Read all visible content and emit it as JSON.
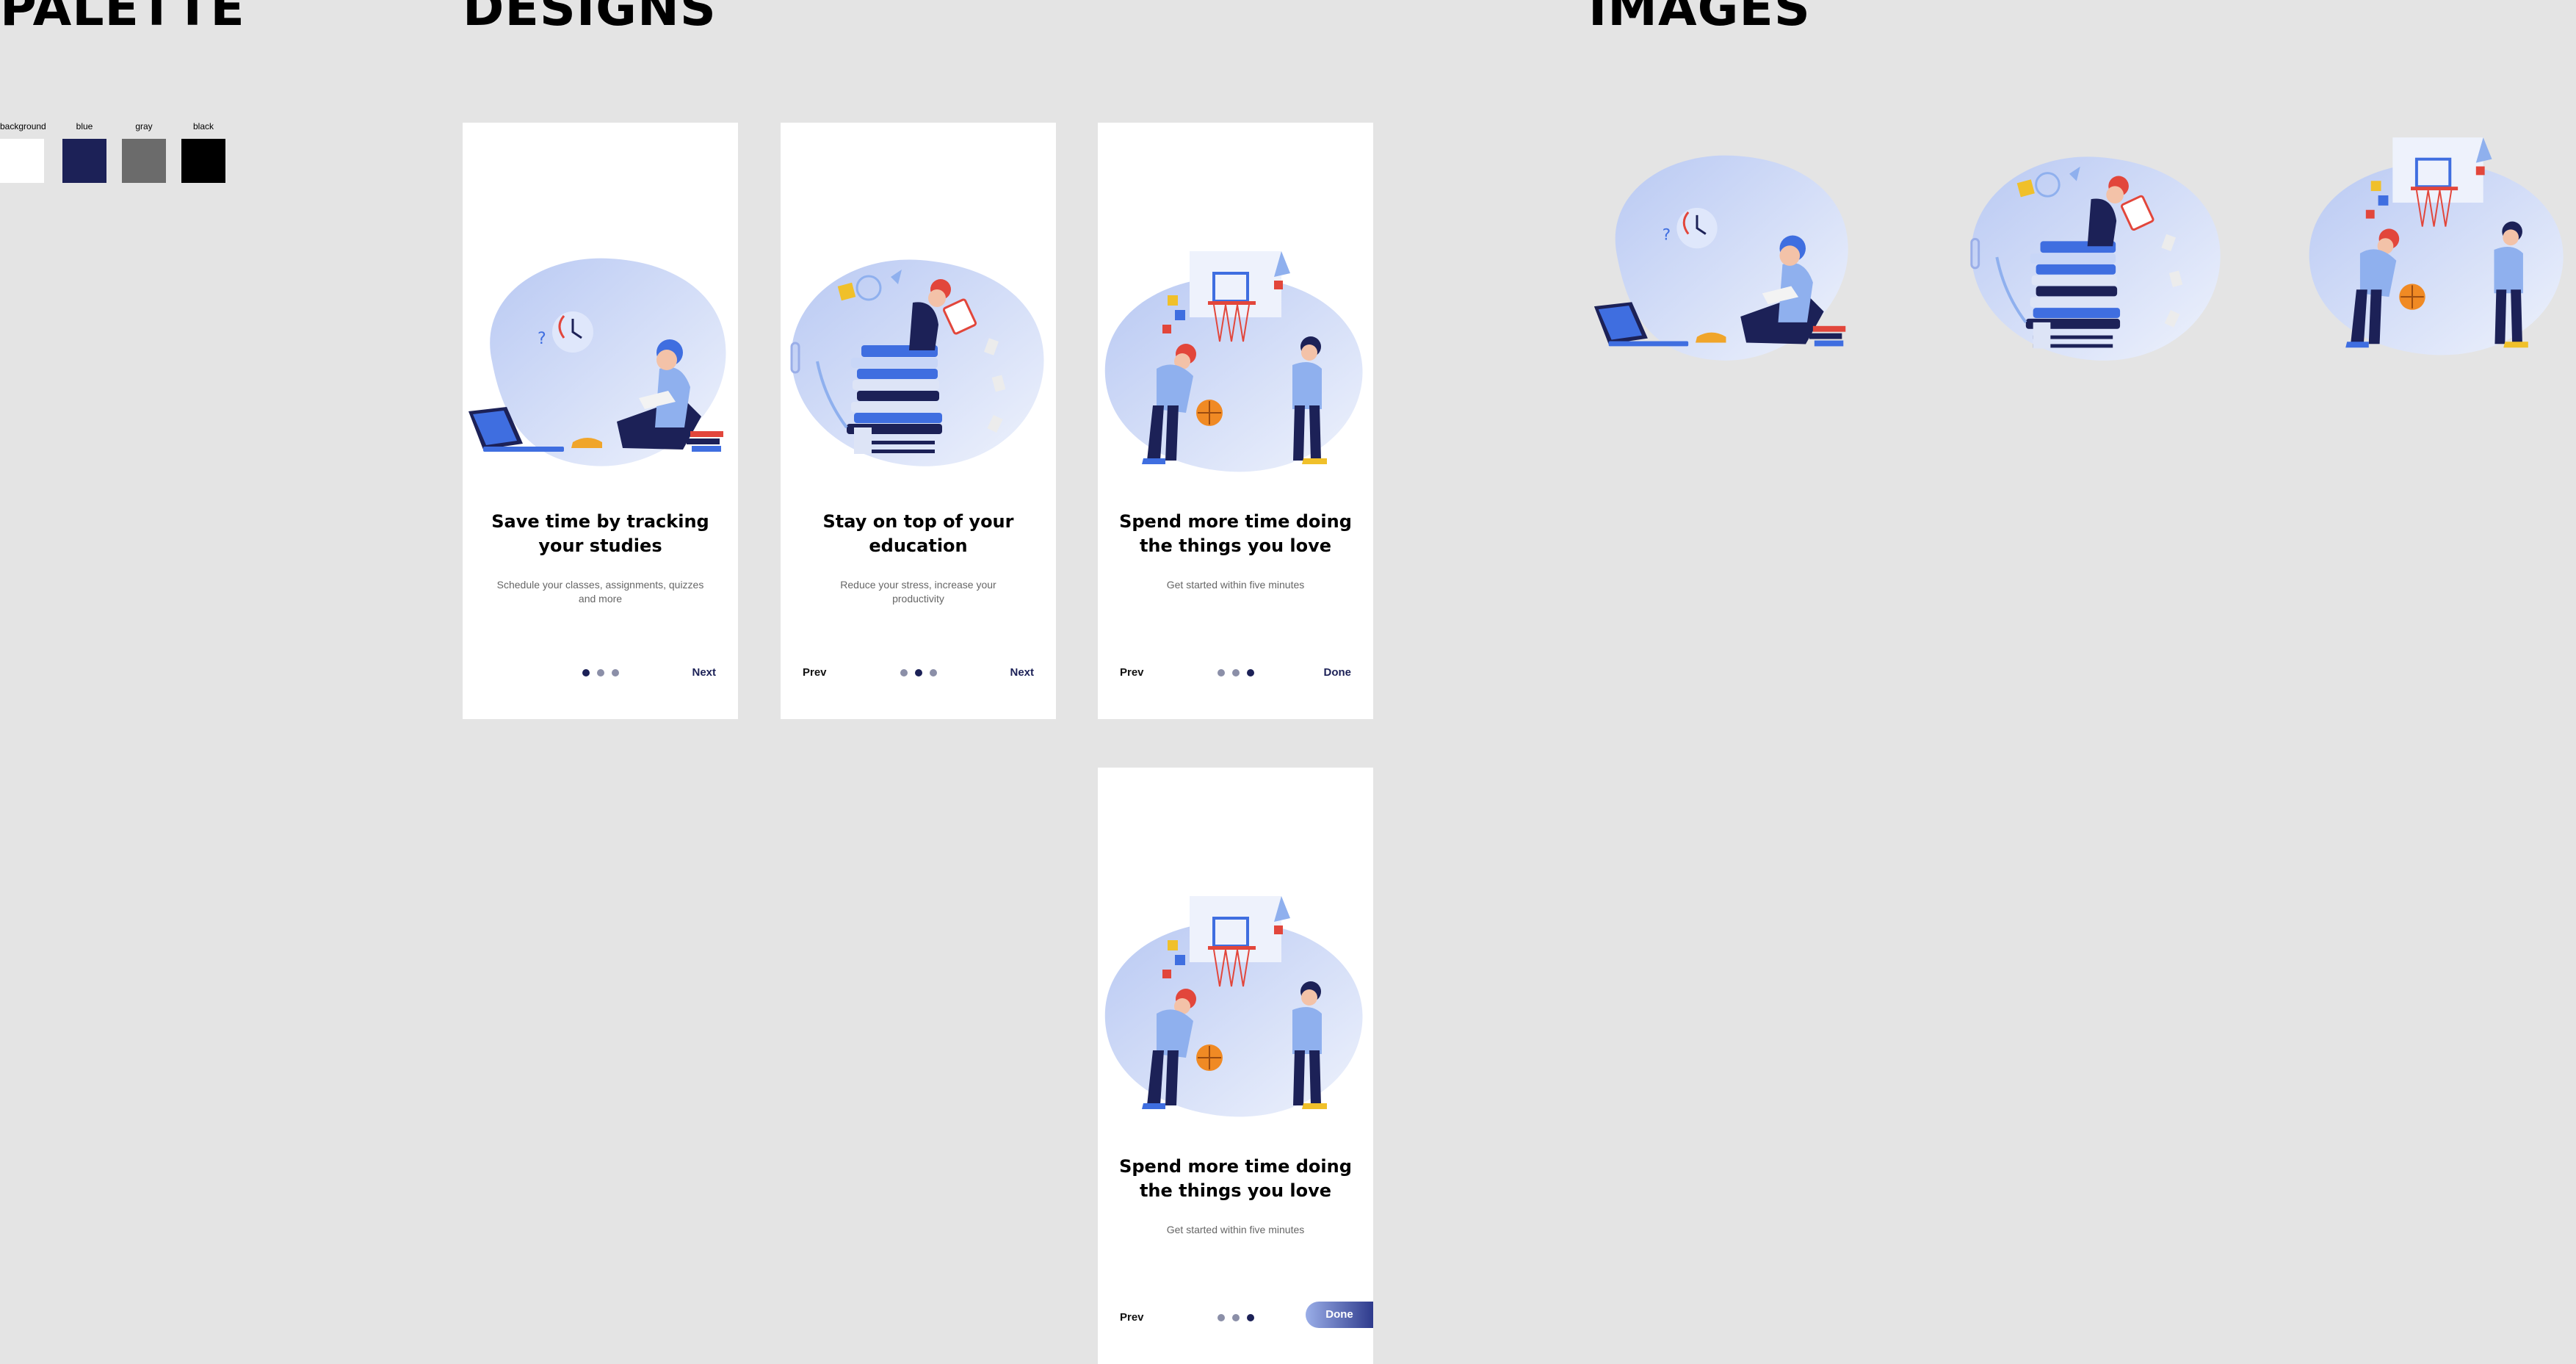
{
  "sections": {
    "palette": "PALETTE",
    "designs": "DESIGNS",
    "images": "IMAGES"
  },
  "palette": [
    {
      "label": "background",
      "color": "#ffffff"
    },
    {
      "label": "blue",
      "color": "#1c2157"
    },
    {
      "label": "gray",
      "color": "#6b6b6b"
    },
    {
      "label": "black",
      "color": "#000000"
    }
  ],
  "cards": [
    {
      "title_line1": "Save time by tracking",
      "title_line2": "your studies",
      "subtitle_line1": "Schedule your classes, assignments, quizzes",
      "subtitle_line2": "and more",
      "prev": "",
      "next": "Next",
      "illustration": "study-laptop-illustration"
    },
    {
      "title_line1": "Stay on top of your",
      "title_line2": "education",
      "subtitle_line1": "Reduce your stress, increase your",
      "subtitle_line2": "productivity",
      "prev": "Prev",
      "next": "Next",
      "illustration": "books-stack-illustration"
    },
    {
      "title_line1": "Spend more time doing",
      "title_line2": "the things you love",
      "subtitle_line1": "Get started within five minutes",
      "subtitle_line2": "",
      "prev": "Prev",
      "next": "Done",
      "illustration": "basketball-illustration"
    },
    {
      "title_line1": "Spend more time doing",
      "title_line2": "the things you love",
      "subtitle_line1": "Get started within five minutes",
      "subtitle_line2": "",
      "prev": "Prev",
      "next": "Done",
      "illustration": "basketball-illustration"
    }
  ],
  "images": [
    "study-laptop-illustration",
    "books-stack-illustration",
    "basketball-illustration"
  ],
  "colors": {
    "blob": "#c9d6f5",
    "navy": "#1c2157",
    "accent_blue": "#3f6ee0",
    "orange": "#f08a24",
    "red": "#e2463b"
  }
}
